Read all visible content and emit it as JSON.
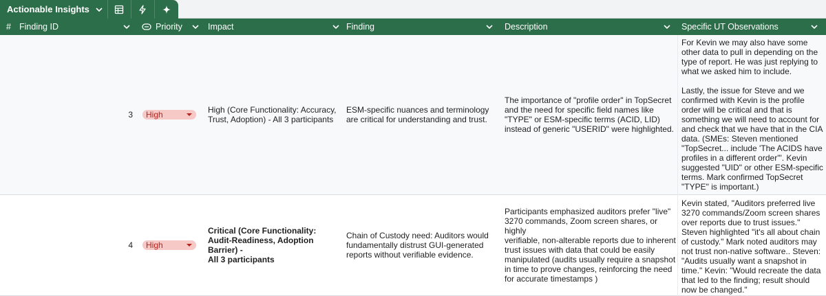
{
  "tab": {
    "title": "Actionable Insights",
    "icons": [
      "table-icon",
      "bolt-icon",
      "sparkle-icon"
    ]
  },
  "columns": {
    "hash": "#",
    "finding_id": "Finding ID",
    "priority": "Priority",
    "impact": "Impact",
    "finding": "Finding",
    "description": "Description",
    "observations": "Specific UT Observations"
  },
  "colors": {
    "header_bg": "#2c6e49",
    "chip_bg": "#f6c9c7",
    "chip_text": "#b3261e"
  },
  "rows": [
    {
      "id": "3",
      "priority": "High",
      "impact": "High (Core Functionality: Accuracy,\nTrust, Adoption) - All 3 participants",
      "finding": "ESM-specific nuances and terminology\nare critical for understanding and trust.",
      "description": "The importance of \"profile order\" in TopSecret\nand the need for specific field names like\n\"TYPE\" or ESM-specific terms (ACID, LID)\ninstead of generic \"USERID\" were highlighted.",
      "observations": "For Kevin we may also have some\nother data to pull in depending on the\ntype of report. He was just replying to\nwhat we asked him to include.\n\nLastly, the issue for Steve and we\nconfirmed with Kevin is the profile\norder will be critical and that is\nsomething we will need to account for\nand check that we have that in the CIA\ndata.   (SMEs: Steven mentioned\n\"TopSecret... include 'The ACIDS have\nprofiles in a different order'\". Kevin\nsuggested \"UID\" or other ESM-specific\nterms. Mark confirmed TopSecret\n\"TYPE\" is important.)"
    },
    {
      "id": "4",
      "priority": "High",
      "impact": "Critical (Core Functionality:\nAudit-Readiness, Adoption Barrier) -\nAll 3 participants",
      "finding": "Chain of Custody need: Auditors would\nfundamentally distrust GUI-generated\nreports without verifiable evidence.",
      "description": "Participants emphasized auditors prefer \"live\"\n3270 commands, Zoom screen shares, or highly\nverifiable, non-alterable reports due to inherent\ntrust issues with data that could be easily\nmanipulated (audits usually require a snapshot\nin time to prove changes, reinforcing the need\nfor accurate timestamps )",
      "observations": "Kevin stated, \"Auditors preferred live\n3270 commands/Zoom screen shares\nover reports due to trust issues.\"\nSteven highlighted \"it's all about chain\nof custody.\" Mark noted auditors may\nnot trust non-native software.. Steven:\n\"Audits usually want a snapshot in\ntime.\" Kevin: \"Would recreate the data\nthat led to the finding; result should\nnow be changed.\""
    }
  ]
}
